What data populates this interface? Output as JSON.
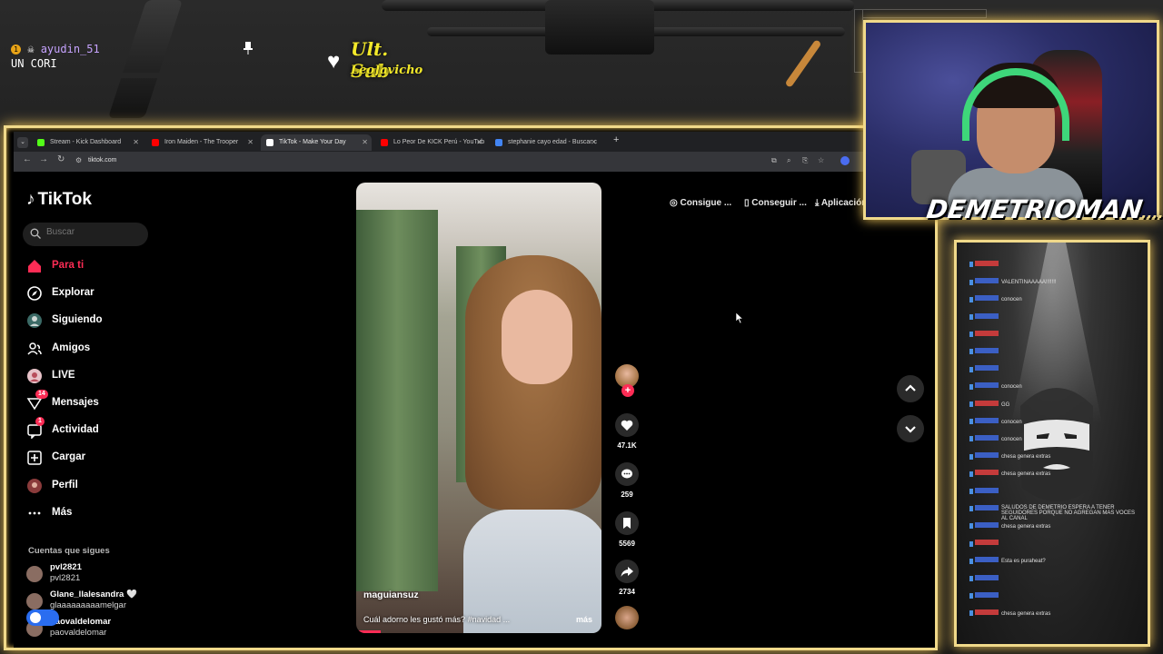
{
  "overlay": {
    "alert_count": "1",
    "alert_user": "ayudin_51",
    "alert_message": "UN CORI",
    "last_sub_title": "Ult. Sub",
    "last_sub_name": "LeoJavicho"
  },
  "browser": {
    "tabs": [
      {
        "label": "Stream - Kick Dashboard",
        "color": "#53fc18",
        "active": false
      },
      {
        "label": "Iron Maiden - The Trooper",
        "color": "#ff0000",
        "active": false
      },
      {
        "label": "TikTok - Make Your Day",
        "color": "#ffffff",
        "active": true
      },
      {
        "label": "Lo Peor De KICK Perú - YouTub",
        "color": "#ff0000",
        "active": false
      },
      {
        "label": "stephanie cayo edad - Buscar c",
        "color": "#4285f4",
        "active": false
      }
    ],
    "url": "tiktok.com"
  },
  "tiktok": {
    "logo_text": "TikTok",
    "search_placeholder": "Buscar",
    "nav": [
      {
        "label": "Para ti",
        "icon": "home-icon",
        "active": true
      },
      {
        "label": "Explorar",
        "icon": "compass-icon",
        "active": false
      },
      {
        "label": "Siguiendo",
        "icon": "following-icon",
        "active": false
      },
      {
        "label": "Amigos",
        "icon": "friends-icon",
        "active": false
      },
      {
        "label": "LIVE",
        "icon": "live-icon",
        "active": false
      },
      {
        "label": "Mensajes",
        "icon": "messages-icon",
        "active": false,
        "badge": "14"
      },
      {
        "label": "Actividad",
        "icon": "activity-icon",
        "active": false,
        "badge": "1"
      },
      {
        "label": "Cargar",
        "icon": "upload-icon",
        "active": false
      },
      {
        "label": "Perfil",
        "icon": "profile-icon",
        "active": false
      },
      {
        "label": "Más",
        "icon": "more-icon",
        "active": false
      }
    ],
    "following_title": "Cuentas que sigues",
    "following": [
      {
        "name": "pvl2821",
        "handle": "pvl2821"
      },
      {
        "name": "Glane_llalesandra 🤍",
        "handle": "glaaaaaaaaamelgar"
      },
      {
        "name": "paovaldelomar",
        "handle": "paovaldelomar"
      }
    ],
    "video": {
      "username": "maguiansuz",
      "caption": "Cuál adorno les gustó más? #navidad ...",
      "more": "más",
      "progress": 0.1
    },
    "actions": {
      "likes": "47.1K",
      "comments": "259",
      "saves": "5569",
      "shares": "2734"
    },
    "top_actions": [
      {
        "label": "Consigue ...",
        "icon": "coin-icon"
      },
      {
        "label": "Conseguir ...",
        "icon": "phone-icon"
      },
      {
        "label": "Aplicación",
        "icon": "download-icon"
      }
    ]
  },
  "stream": {
    "streamer_name": "DEMETRIOMAN",
    "name_suffix": "...."
  },
  "chat": {
    "lines": [
      {
        "user": "",
        "text": ""
      },
      {
        "user": "",
        "text": "VALENTINAAAAA!!!!!!!"
      },
      {
        "user": "",
        "text": "conocen"
      },
      {
        "user": "",
        "text": ""
      },
      {
        "user": "",
        "text": ""
      },
      {
        "user": "",
        "text": ""
      },
      {
        "user": "",
        "text": ""
      },
      {
        "user": "",
        "text": "conocen"
      },
      {
        "user": "",
        "text": "GG"
      },
      {
        "user": "",
        "text": "conocen"
      },
      {
        "user": "",
        "text": "conocen"
      },
      {
        "user": "",
        "text": "chesa genera extras"
      },
      {
        "user": "",
        "text": "chesa genera extras"
      },
      {
        "user": "",
        "text": ""
      },
      {
        "user": "",
        "text": "SALUDOS DE DEMETRIO ESPERA A TENER SEGUIDORES PORQUE NO AGREGAN MAS VOCES AL CANAL"
      },
      {
        "user": "",
        "text": "chesa genera extras"
      },
      {
        "user": "",
        "text": ""
      },
      {
        "user": "",
        "text": "Esta es puraheat?"
      },
      {
        "user": "",
        "text": ""
      },
      {
        "user": "",
        "text": ""
      },
      {
        "user": "",
        "text": "chesa genera extras"
      }
    ]
  },
  "colors": {
    "accent": "#fe2c55",
    "frame_glow": "#f0d98a",
    "sub_yellow": "#f3e92a"
  }
}
